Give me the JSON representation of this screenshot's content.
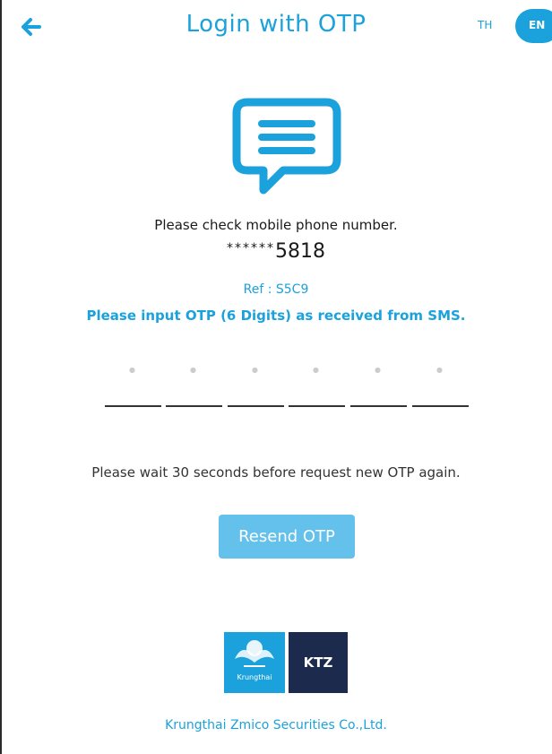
{
  "header": {
    "title": "Login with OTP",
    "back_icon": "arrow-left-icon",
    "languages": [
      {
        "label": "TH",
        "selected": false
      },
      {
        "label": "EN",
        "selected": true
      }
    ]
  },
  "message_icon": "chat-bubble-icon",
  "check": {
    "text": "Please check mobile phone number.",
    "masked_prefix": "******",
    "phone_suffix": "5818"
  },
  "ref": {
    "text": "Ref : S5C9"
  },
  "instruction": "Please input OTP (6 Digits) as received from SMS.",
  "otp": {
    "digit_count": 6,
    "values": [
      "",
      "",
      "",
      "",
      "",
      ""
    ]
  },
  "wait_text": "Please wait 30 seconds before request new OTP again.",
  "resend_label": "Resend OTP",
  "footer": {
    "logo_krungthai_label": "Krungthai",
    "logo_ktz_label": "KTZ",
    "company": "Krungthai Zmico Securities Co.,Ltd."
  },
  "colors": {
    "accent": "#1ba2dc",
    "button_disabled": "#63c1ec",
    "ktz_navy": "#1c2a4d"
  }
}
